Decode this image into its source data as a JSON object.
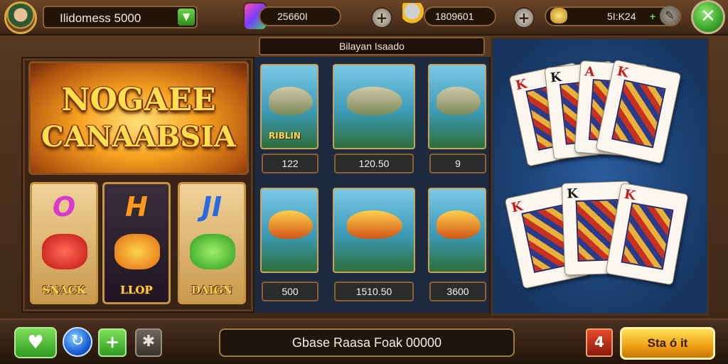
{
  "topbar": {
    "username": "Ilidomess 5000",
    "gems": "25660I",
    "fish_coins": "1809601",
    "gold": "5I:K24"
  },
  "panel_title": "Bilayan Isaado",
  "banner": {
    "line1": "NOGAEE",
    "line2": "CANAABSIA"
  },
  "slots": [
    {
      "letter": "O",
      "label": "SNACK"
    },
    {
      "letter": "H",
      "label": "LLOP"
    },
    {
      "letter": "JI",
      "label": "DAIGN"
    }
  ],
  "fish_cards": [
    {
      "label": "RIBLIN",
      "value": "122"
    },
    {
      "label": "",
      "value": "120.50"
    },
    {
      "label": "",
      "value": "9"
    },
    {
      "label": "",
      "value": "500"
    },
    {
      "label": "",
      "value": "1510.50"
    },
    {
      "label": "",
      "value": "3600"
    }
  ],
  "playing_cards": [
    {
      "rank": "K",
      "suit": "♦",
      "color": "red"
    },
    {
      "rank": "K",
      "suit": "♣",
      "color": "black"
    },
    {
      "rank": "A",
      "suit": "♦",
      "color": "red"
    },
    {
      "rank": "K",
      "suit": "♥",
      "color": "red"
    },
    {
      "rank": "K",
      "suit": "♥",
      "color": "red"
    },
    {
      "rank": "K",
      "suit": "♣",
      "color": "black"
    },
    {
      "rank": "K",
      "suit": "♥",
      "color": "red"
    }
  ],
  "bottombar": {
    "message": "Gbase Raasa Foak 00000",
    "start_label": "Sta ó it",
    "card_btn_label": "4"
  },
  "icons": {
    "close": "close-icon",
    "heart": "heart-icon",
    "gear": "gear-icon",
    "plus": "plus-icon"
  },
  "colors": {
    "accent_green": "#2f9a20",
    "accent_gold": "#f0a012",
    "frame_brown": "#5a3a22",
    "table_blue": "#1f4a86"
  }
}
